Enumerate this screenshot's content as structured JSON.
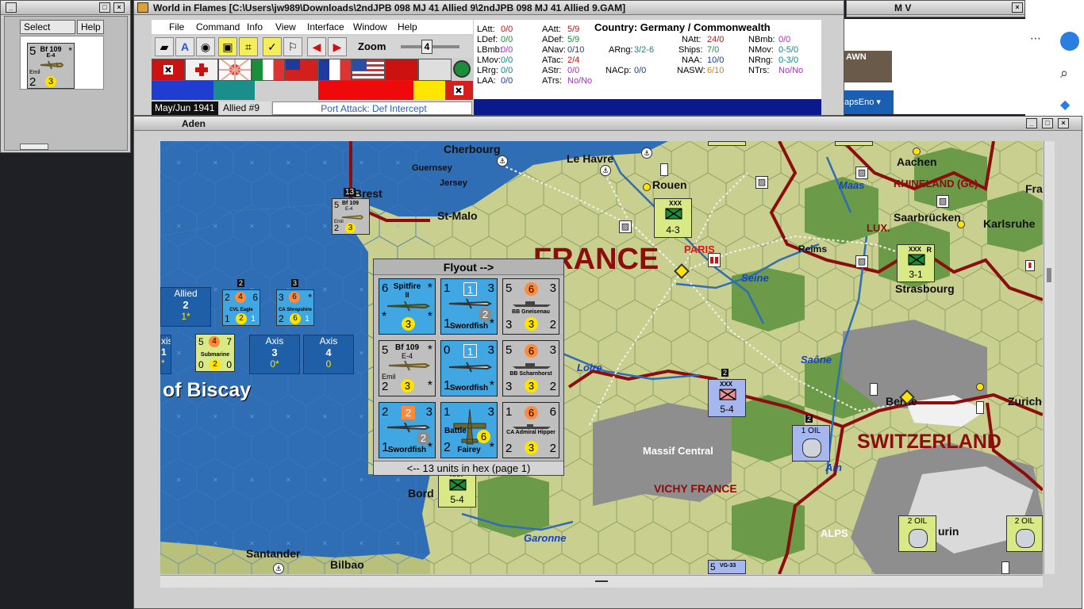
{
  "select_panel": {
    "select_label": "Select",
    "help_label": "Help",
    "mini_counter": {
      "left": "5",
      "name": "Bf 109",
      "sub": "E-4",
      "nick": "Emil",
      "bottom_left": "2",
      "circle": "3",
      "star": "*"
    }
  },
  "main_window": {
    "title": "World in Flames [C:\\Users\\jw989\\Downloads\\2ndJPB 098 MJ 41 Allied 9\\2ndJPB 098 MJ 41 Allied 9.GAM]",
    "menu": [
      "File",
      "Command",
      "Info",
      "View",
      "Interface",
      "Window",
      "Help"
    ],
    "zoom_label": "Zoom",
    "zoom_value": "4",
    "date": "May/Jun 1941",
    "impulse": "Allied #9",
    "phase": "Port Attack: Def Intercept"
  },
  "stats": {
    "country": "Country: Germany / Commonwealth",
    "LAtt_l": "LAtt:",
    "LAtt_v": "0/0",
    "LDef_l": "LDef:",
    "LDef_v": "0/0",
    "LBmb_l": "LBmb:",
    "LBmb_v": "0/0",
    "LMov_l": "LMov:",
    "LMov_v": "0/0",
    "LRrg_l": "LRrg:",
    "LRrg_v": "0/0",
    "LAA_l": "LAA:",
    "LAA_v": "0/0",
    "AAtt_l": "AAtt:",
    "AAtt_v": "5/9",
    "ADef_l": "ADef:",
    "ADef_v": "5/9",
    "ANav_l": "ANav:",
    "ANav_v": "0/10",
    "ATac_l": "ATac:",
    "ATac_v": "2/4",
    "AStr_l": "AStr:",
    "AStr_v": "0/0",
    "ATrs_l": "ATrs:",
    "ATrs_v": "No/No",
    "ARng_l": "ARng:",
    "ARng_v": "3/2-6",
    "NACp_l": "NACp:",
    "NACp_v": "0/0",
    "NAtt_l": "NAtt:",
    "NAtt_v": "24/0",
    "Ships_l": "Ships:",
    "Ships_v": "7/0",
    "NAA_l": "NAA:",
    "NAA_v": "10/0",
    "NASW_l": "NASW:",
    "NASW_v": "6/10",
    "NBmb_l": "NBmb:",
    "NBmb_v": "0/0",
    "NMov_l": "NMov:",
    "NMov_v": "0-5/0",
    "NRng_l": "NRng:",
    "NRng_v": "0-3/0",
    "NTrs_l": "NTrs:",
    "NTrs_v": "No/No"
  },
  "mv_window": {
    "title": "M V"
  },
  "browser": {
    "strip_text": "AWN",
    "tab_text": "apsEno ▾"
  },
  "map_window": {
    "title": "Aden"
  },
  "map": {
    "cities": [
      "Cherbourg",
      "Le Havre",
      "Guernsey",
      "Jersey",
      "Brest",
      "St-Malo",
      "Rouen",
      "PARIS",
      "Reims",
      "Aachen",
      "Frank",
      "Saarbrücken",
      "Karlsruhe",
      "Strasbourg",
      "Berne",
      "Zurich",
      "Santander",
      "Bilbao",
      "Bord",
      "urin"
    ],
    "countries": [
      "FRANCE",
      "SWITZERLAND",
      "RHINELAND (Ge)",
      "LUX.",
      "VICHY FRANCE",
      "Massif Central",
      "ALPS"
    ],
    "sea": "of Biscay",
    "rivers": [
      "Seine",
      "Maas",
      "Loire",
      "Saône",
      "Ain",
      "Garonne"
    ]
  },
  "sea_boxes": [
    {
      "line1": "Allied",
      "line2": "2",
      "line3": "1*"
    },
    {
      "line1": "xis",
      "line2": "1",
      "line3": "*"
    },
    {
      "line1": "Axis",
      "line2": "3",
      "line3": "0*"
    },
    {
      "line1": "Axis",
      "line2": "4",
      "line3": "0"
    }
  ],
  "map_counters": {
    "brest_stack": {
      "badge": "13",
      "left": "5",
      "name": "Bf 109",
      "sub": "E-4",
      "nick": "Emil",
      "bottom_left": "2",
      "circle": "3"
    },
    "cvl_eagle": {
      "badge": "2",
      "a": "2",
      "b": "4",
      "c": "6",
      "name": "CVL Eagle",
      "d": "1",
      "e": "2",
      "f": "1"
    },
    "ca_shropshire": {
      "badge": "3",
      "a": "3",
      "b": "6",
      "c": "*",
      "name": "CA Shropshire",
      "d": "2",
      "e": "6",
      "f": "1"
    },
    "submarine": {
      "a": "5",
      "b": "4",
      "c": "7",
      "name": "Submarine",
      "d": "0",
      "e": "2",
      "f": "0"
    },
    "rouen_inf": {
      "size": "XXX",
      "value": "4-3"
    },
    "strasbourg_inf": {
      "size": "XXX",
      "value": "3-1",
      "r": "R"
    },
    "loire_inf": {
      "badge": "2",
      "size": "XXX",
      "value": "5-4"
    },
    "oil_1": {
      "badge": "2",
      "value": "1 OIL"
    },
    "oil_2": {
      "value": "2 OIL"
    },
    "oil_3": {
      "value": "2 OIL"
    },
    "bord_inf": {
      "size": "XXX",
      "value": "5-4"
    },
    "bottom_unit": {
      "a": "5",
      "name": "VG-33"
    }
  },
  "flyout": {
    "title": "Flyout -->",
    "footer": "<-- 13 units in hex (page 1)",
    "cells": [
      {
        "tl": "6",
        "name": "Spitfire",
        "sub": "II",
        "tr": "*",
        "bl": "*",
        "circle": "3",
        "br": "*"
      },
      {
        "tl": "1",
        "box": "1",
        "tr": "3",
        "name": "Swordfish",
        "mid": "2",
        "bl": "1",
        "br": "*"
      },
      {
        "tl": "5",
        "oc": "6",
        "tr": "3",
        "name": "BB Gneisenau",
        "bl": "3",
        "gc": "3",
        "br": "2"
      },
      {
        "tl": "5",
        "name": "Bf 109",
        "sub": "E-4",
        "tr": "*",
        "nick": "Emil",
        "bl": "2",
        "circle": "3",
        "br": "*"
      },
      {
        "tl": "0",
        "box": "1",
        "tr": "3",
        "name": "Swordfish",
        "bl": "1",
        "br": "*"
      },
      {
        "tl": "5",
        "oc": "6",
        "tr": "3",
        "name": "BB Scharnhorst",
        "bl": "3",
        "gc": "3",
        "br": "2"
      },
      {
        "tl": "2",
        "box": "2",
        "tr": "3",
        "mid": "2",
        "name": "Swordfish",
        "bl": "1",
        "br": "*"
      },
      {
        "tl": "1",
        "tr": "3",
        "name": "Battle",
        "circle": "6",
        "name2": "Fairey",
        "bl": "2",
        "br": "*"
      },
      {
        "tl": "1",
        "oc": "6",
        "tr": "6",
        "name": "CA Admiral Hipper",
        "bl": "2",
        "circle": "3",
        "br": "2"
      }
    ]
  },
  "colors": {
    "sea": "#2f6db5",
    "land": "#c9cf8e",
    "forest": "#6b9a48",
    "mountain": "#8e8e8e",
    "border_red": "#8b0d0d",
    "river": "#2f6db5",
    "allied_counter": "#41a7e2",
    "axis_counter": "#bfbfbf",
    "french_counter": "#d8e985",
    "vichy_counter": "#a6b7ef"
  }
}
